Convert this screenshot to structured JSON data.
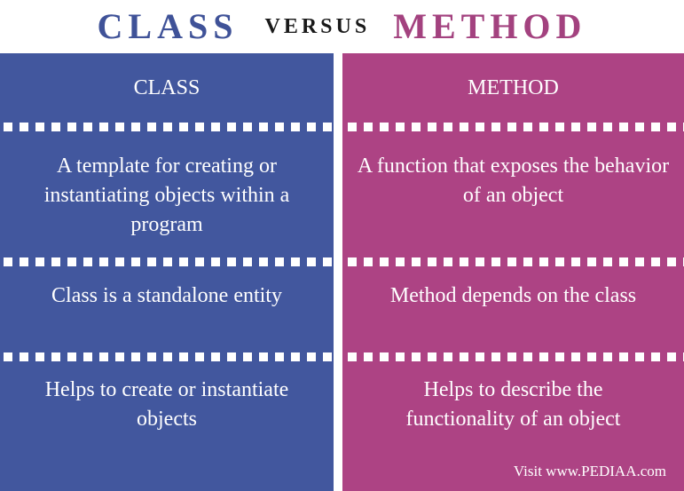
{
  "title": {
    "left": "CLASS",
    "middle": "VERSUS",
    "right": "METHOD"
  },
  "columns": [
    {
      "header": "CLASS",
      "rows": [
        "A template for creating or instantiating objects within a program",
        "Class is a standalone entity",
        "Helps to create or instantiate objects"
      ]
    },
    {
      "header": "METHOD",
      "rows": [
        "A function that exposes the behavior of an object",
        "Method depends on the class",
        "Helps to describe the functionality of an object"
      ]
    }
  ],
  "credit": "Visit www.PEDIAA.com",
  "colors": {
    "class_blue": "#42579e",
    "method_magenta": "#ad4384",
    "title_blue": "#3f5298",
    "title_magenta": "#a3427f"
  }
}
